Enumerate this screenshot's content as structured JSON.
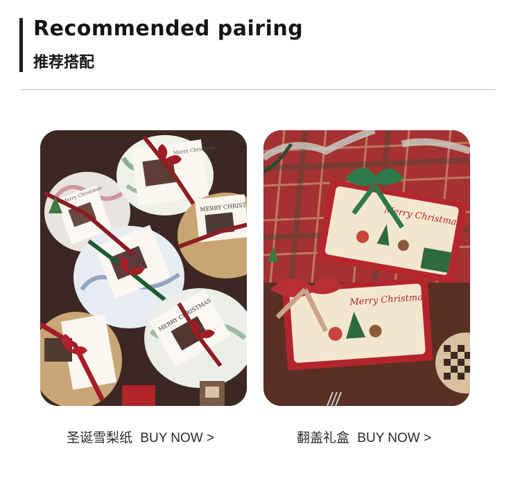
{
  "header": {
    "title_en": "Recommended pairing",
    "title_cn": "推荐搭配"
  },
  "products": [
    {
      "name": "圣诞雪梨纸",
      "cta": "BUY NOW >",
      "image_texts": [
        "Merry Christmas",
        "MERRY CHRISTMAS",
        "MERRY CHRISTMAS"
      ]
    },
    {
      "name": "翻盖礼盒",
      "cta": "BUY NOW >",
      "image_texts": [
        "Merry Christmas",
        "Merry Christmas"
      ]
    }
  ]
}
